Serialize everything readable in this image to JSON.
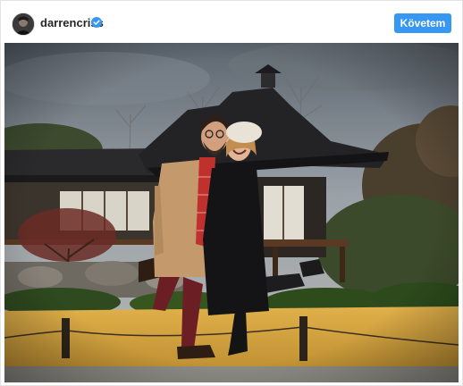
{
  "post": {
    "username": "darrencriss",
    "verified": true,
    "follow_label": "Követem"
  },
  "icons": {
    "avatar": "profile-avatar",
    "verified": "verified-badge-icon"
  },
  "colors": {
    "follow_button": "#3897f0",
    "verified_badge": "#3897f0",
    "username_text": "#262626"
  }
}
